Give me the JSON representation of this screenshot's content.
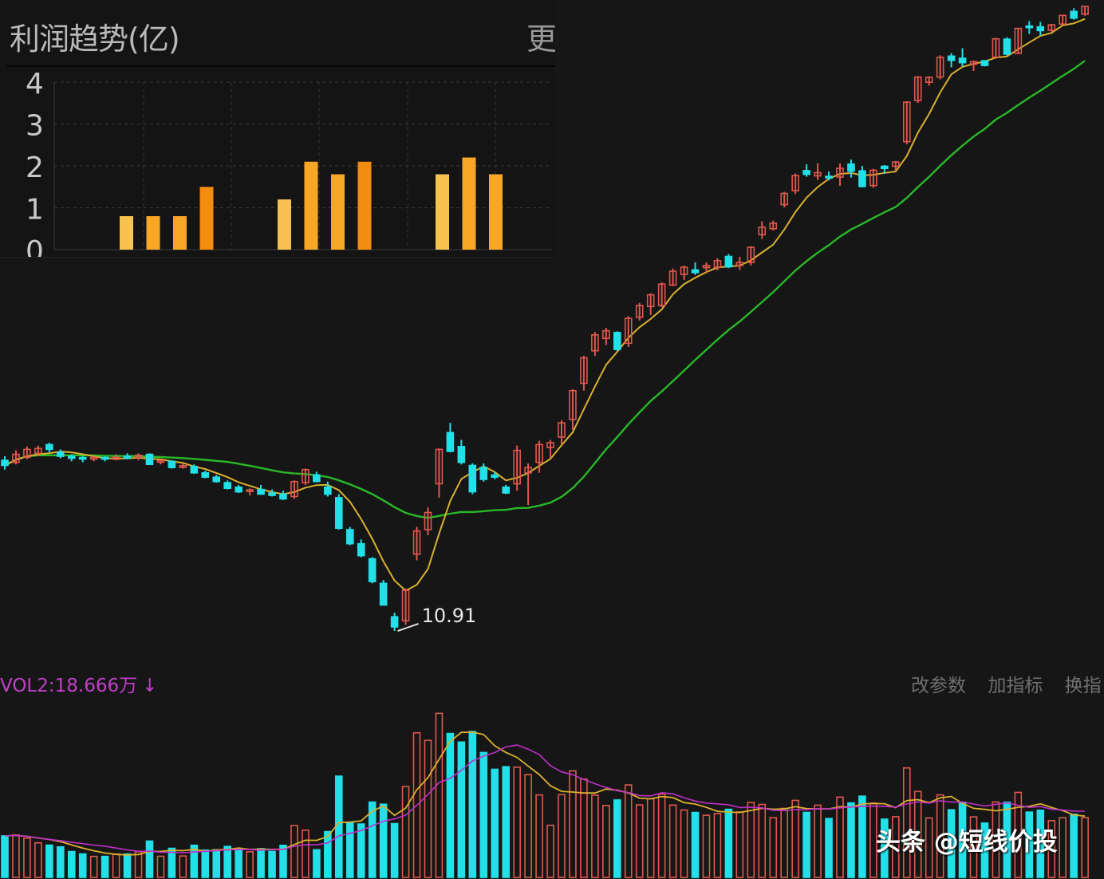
{
  "profit_panel": {
    "title": "利润趋势(亿)",
    "more_label": "更"
  },
  "volume_panel": {
    "label": "VOL2:18.666万",
    "arrow": "↓",
    "buttons": [
      "改参数",
      "加指标",
      "换指"
    ]
  },
  "watermark": "头条 @短线价投",
  "colors": {
    "background": "#161616",
    "up_candle": "#e0584e",
    "down_candle": "#22dfe8",
    "ma_short": "#d9b02e",
    "ma_long": "#28b828",
    "vol_ma_magenta": "#c030c8",
    "bar_light": "#f7c252",
    "bar_mid": "#f7a725",
    "bar_dark": "#f48c10"
  },
  "chart_data": [
    {
      "type": "bar",
      "title": "利润趋势(亿)",
      "yticks": [
        "4",
        "3",
        "2",
        "1",
        "0"
      ],
      "ylim": [
        0,
        4
      ],
      "grid": true,
      "groups": [
        {
          "values": [
            0.8,
            0.8,
            0.8,
            1.5
          ]
        },
        {
          "values": [
            1.2,
            2.1,
            1.8,
            2.1
          ]
        },
        {
          "values": [
            1.8,
            2.2,
            1.8
          ]
        }
      ]
    },
    {
      "type": "candlestick",
      "annotation": "10.91",
      "candles": [
        [
          22.8,
          23.2,
          21.9,
          22.3
        ],
        [
          22.6,
          23.8,
          22.4,
          23.4
        ],
        [
          23.1,
          24.2,
          22.9,
          23.9
        ],
        [
          23.5,
          24.3,
          23.2,
          24.0
        ],
        [
          24.4,
          24.6,
          23.6,
          23.9
        ],
        [
          23.6,
          23.9,
          23.0,
          23.2
        ],
        [
          23.2,
          23.4,
          22.7,
          23.0
        ],
        [
          23.0,
          23.2,
          22.6,
          22.9
        ],
        [
          22.9,
          23.2,
          22.7,
          23.0
        ],
        [
          23.0,
          23.2,
          22.7,
          22.9
        ],
        [
          22.9,
          23.4,
          22.8,
          23.1
        ],
        [
          23.2,
          23.5,
          22.9,
          23.0
        ],
        [
          23.1,
          23.5,
          22.8,
          23.3
        ],
        [
          23.4,
          23.5,
          22.4,
          22.4
        ],
        [
          22.6,
          22.9,
          22.4,
          22.7
        ],
        [
          22.7,
          22.8,
          22.0,
          22.1
        ],
        [
          22.1,
          22.5,
          22.0,
          22.2
        ],
        [
          22.2,
          22.4,
          21.5,
          21.6
        ],
        [
          21.6,
          21.8,
          21.1,
          21.2
        ],
        [
          21.2,
          21.4,
          20.7,
          20.8
        ],
        [
          20.7,
          20.9,
          20.1,
          20.2
        ],
        [
          20.3,
          20.5,
          19.8,
          19.9
        ],
        [
          19.9,
          20.2,
          19.6,
          20.0
        ],
        [
          20.1,
          20.5,
          19.8,
          19.7
        ],
        [
          19.8,
          20.1,
          19.5,
          19.6
        ],
        [
          19.7,
          20.0,
          19.2,
          19.3
        ],
        [
          19.5,
          20.9,
          19.3,
          20.8
        ],
        [
          20.7,
          22.0,
          20.5,
          21.9
        ],
        [
          21.4,
          21.7,
          21.0,
          20.8
        ],
        [
          20.3,
          20.8,
          19.5,
          19.7
        ],
        [
          19.4,
          19.7,
          16.9,
          17.0
        ],
        [
          16.9,
          17.1,
          15.8,
          15.9
        ],
        [
          15.9,
          16.2,
          15.0,
          15.1
        ],
        [
          14.9,
          15.0,
          13.4,
          13.5
        ],
        [
          13.4,
          13.6,
          12.2,
          12.2
        ],
        [
          11.6,
          11.8,
          10.91,
          11.1
        ],
        [
          11.4,
          13.1,
          11.2,
          13.0
        ],
        [
          15.2,
          17.1,
          14.8,
          16.8
        ],
        [
          16.9,
          18.6,
          16.5,
          18.2
        ],
        [
          20.6,
          24.0,
          19.4,
          23.9
        ],
        [
          25.7,
          26.8,
          23.6,
          23.7
        ],
        [
          24.2,
          24.9,
          22.4,
          22.6
        ],
        [
          22.3,
          22.5,
          19.7,
          19.9
        ],
        [
          22.1,
          22.5,
          20.8,
          21.0
        ],
        [
          21.4,
          21.7,
          21.0,
          21.2
        ],
        [
          20.3,
          20.5,
          19.7,
          19.8
        ],
        [
          20.6,
          24.3,
          20.0,
          23.8
        ],
        [
          21.6,
          22.5,
          18.8,
          22.1
        ],
        [
          22.6,
          24.8,
          21.6,
          24.4
        ],
        [
          24.1,
          24.9,
          23.0,
          24.6
        ],
        [
          25.2,
          27.1,
          24.4,
          26.8
        ],
        [
          27.2,
          31.0,
          26.0,
          30.8
        ],
        [
          31.8,
          35.8,
          30.8,
          35.5
        ],
        [
          36.6,
          39.7,
          35.8,
          39.2
        ],
        [
          38.6,
          40.4,
          37.5,
          39.9
        ],
        [
          39.6,
          39.8,
          36.6,
          36.8
        ],
        [
          37.8,
          42.5,
          37.2,
          42.1
        ],
        [
          42.3,
          45.0,
          41.7,
          44.5
        ],
        [
          44.3,
          46.9,
          42.7,
          46.6
        ],
        [
          44.5,
          49.2,
          44.2,
          48.8
        ],
        [
          48.6,
          52.2,
          48.4,
          51.6
        ],
        [
          50.9,
          52.9,
          49.7,
          52.5
        ],
        [
          51.9,
          53.6,
          50.8,
          51.3
        ],
        [
          52.4,
          53.6,
          51.1,
          52.9
        ],
        [
          52.5,
          54.6,
          51.8,
          54.0
        ],
        [
          55.0,
          55.6,
          52.3,
          52.6
        ],
        [
          52.9,
          54.9,
          51.9,
          53.6
        ],
        [
          53.6,
          57.5,
          52.9,
          57.2
        ],
        [
          60.4,
          64.0,
          59.3,
          62.4
        ],
        [
          62.0,
          64.2,
          61.6,
          63.5
        ],
        [
          68.8,
          72.7,
          68.0,
          72.2
        ],
        [
          73.1,
          78.7,
          72.0,
          78.0
        ],
        [
          79.7,
          81.9,
          77.6,
          78.4
        ],
        [
          77.9,
          82.3,
          76.5,
          79.0
        ],
        [
          77.5,
          79.4,
          76.4,
          77.0
        ],
        [
          77.5,
          82.2,
          74.6,
          80.5
        ],
        [
          82.0,
          83.6,
          77.3,
          79.5
        ],
        [
          79.6,
          81.3,
          74.1,
          74.4
        ],
        [
          74.7,
          80.3,
          74.0,
          79.8
        ],
        [
          81.2,
          81.6,
          78.6,
          80.4
        ],
        [
          81.2,
          83.1,
          79.5,
          82.7
        ],
        [
          90.3,
          107.5,
          89.3,
          107.1
        ],
        [
          107.9,
          119.8,
          106.8,
          119.4
        ],
        [
          116.7,
          119.8,
          115.0,
          119.2
        ],
        [
          119.4,
          131.2,
          118.2,
          130.0
        ],
        [
          130.7,
          132.4,
          124.5,
          128.3
        ],
        [
          129.5,
          135.2,
          124.9,
          127.0
        ],
        [
          126.2,
          128.1,
          122.6,
          127.6
        ],
        [
          128.1,
          128.4,
          125.0,
          125.5
        ],
        [
          130.1,
          141.4,
          129.9,
          140.8
        ],
        [
          140.6,
          141.8,
          131.1,
          131.8
        ],
        [
          132.3,
          147.6,
          131.9,
          147.3
        ],
        [
          148.3,
          152.0,
          143.8,
          147.5
        ],
        [
          148.3,
          151.5,
          142.7,
          145.9
        ],
        [
          146.1,
          150.2,
          145.2,
          149.6
        ],
        [
          150.1,
          156.2,
          149.8,
          155.8
        ],
        [
          158.5,
          160.7,
          153.0,
          154.0
        ],
        [
          156.7,
          162.3,
          155.6,
          162.0
        ]
      ]
    },
    {
      "type": "bar",
      "title": "VOL2",
      "legend": [
        "VOL2:18.666万"
      ]
    }
  ]
}
